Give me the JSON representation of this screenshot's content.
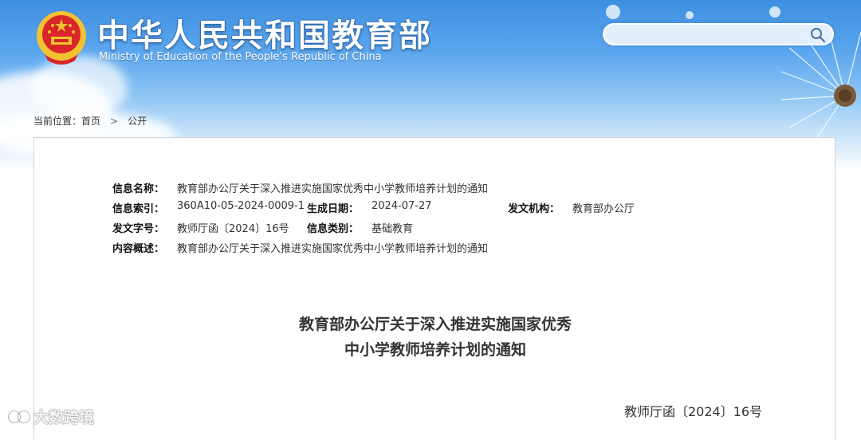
{
  "header": {
    "title_cn": "中华人民共和国教育部",
    "title_en": "Ministry of Education of the People's Republic of China",
    "search": {
      "value": "",
      "placeholder": ""
    },
    "icons": {
      "emblem": "national-emblem-icon",
      "search": "search-icon"
    }
  },
  "breadcrumb": {
    "prefix": "当前位置：",
    "home": "首页",
    "separator": ">",
    "current": "公开"
  },
  "meta": {
    "name_label": "信息名称：",
    "name_value": "教育部办公厅关于深入推进实施国家优秀中小学教师培养计划的通知",
    "index_label": "信息索引：",
    "index_value": "360A10-05-2024-0009-1",
    "date_label": "生成日期：",
    "date_value": "2024-07-27",
    "agency_label": "发文机构：",
    "agency_value": "教育部办公厅",
    "docno_label": "发文字号：",
    "docno_value": "教师厅函〔2024〕16号",
    "category_label": "信息类别：",
    "category_value": "基础教育",
    "summary_label": "内容概述：",
    "summary_value": "教育部办公厅关于深入推进实施国家优秀中小学教师培养计划的通知"
  },
  "document": {
    "title_line1": "教育部办公厅关于深入推进实施国家优秀",
    "title_line2": "中小学教师培养计划的通知",
    "doc_number": "教师厅函〔2024〕16号"
  },
  "watermark": {
    "text": "大数跨境"
  },
  "colors": {
    "header_blue": "#3f8fe0",
    "emblem_red": "#d8262b",
    "emblem_gold": "#f2c230",
    "panel_border": "#c9d3dd"
  }
}
